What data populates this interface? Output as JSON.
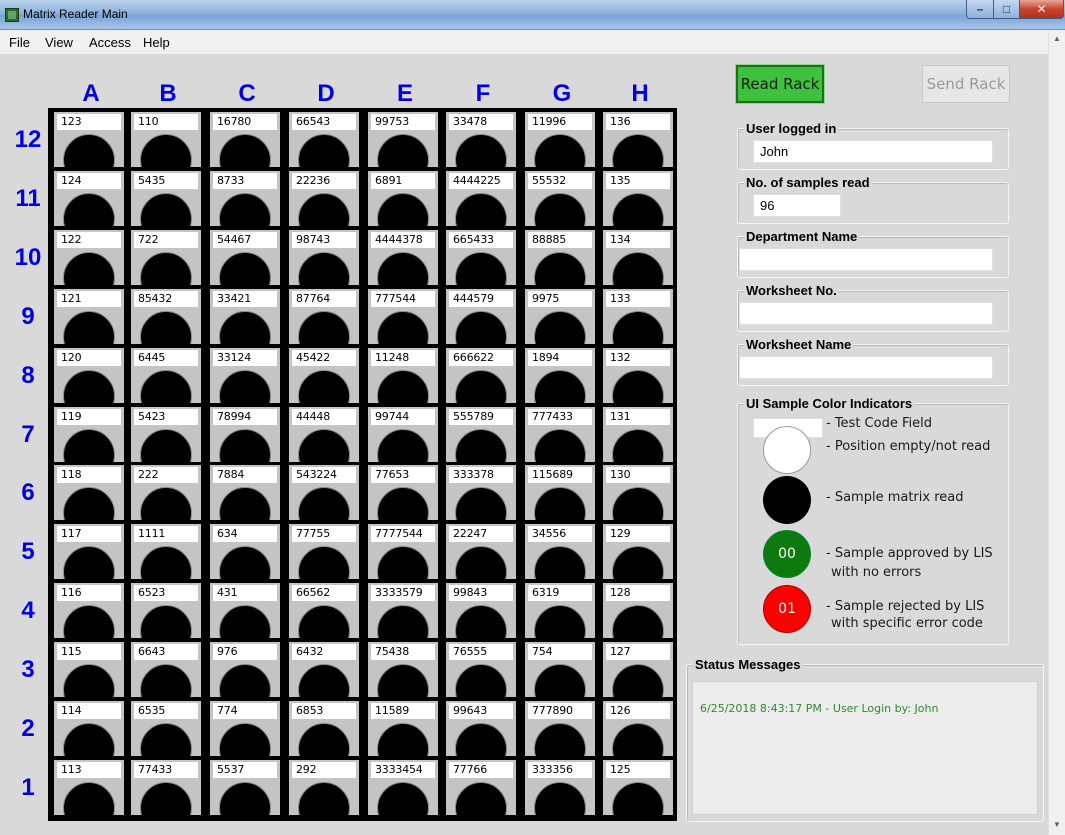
{
  "window": {
    "title": "Matrix Reader Main",
    "minimize": "–",
    "maximize": "□",
    "close": "✕"
  },
  "menu": [
    "File",
    "View",
    "Access",
    "Help"
  ],
  "rack": {
    "columns": [
      "A",
      "B",
      "C",
      "D",
      "E",
      "F",
      "G",
      "H"
    ],
    "rows": [
      "12",
      "11",
      "10",
      "9",
      "8",
      "7",
      "6",
      "5",
      "4",
      "3",
      "2",
      "1"
    ],
    "cells": [
      [
        "123",
        "110",
        "16780",
        "66543",
        "99753",
        "33478",
        "11996",
        "136"
      ],
      [
        "124",
        "5435",
        "8733",
        "22236",
        "6891",
        "4444225",
        "55532",
        "135"
      ],
      [
        "122",
        "722",
        "54467",
        "98743",
        "4444378",
        "665433",
        "88885",
        "134"
      ],
      [
        "121",
        "85432",
        "33421",
        "87764",
        "777544",
        "444579",
        "9975",
        "133"
      ],
      [
        "120",
        "6445",
        "33124",
        "45422",
        "11248",
        "666622",
        "1894",
        "132"
      ],
      [
        "119",
        "5423",
        "78994",
        "44448",
        "99744",
        "555789",
        "777433",
        "131"
      ],
      [
        "118",
        "222",
        "7884",
        "543224",
        "77653",
        "333378",
        "115689",
        "130"
      ],
      [
        "117",
        "1111",
        "634",
        "77755",
        "7777544",
        "22247",
        "34556",
        "129"
      ],
      [
        "116",
        "6523",
        "431",
        "66562",
        "3333579",
        "99843",
        "6319",
        "128"
      ],
      [
        "115",
        "6643",
        "976",
        "6432",
        "75438",
        "76555",
        "754",
        "127"
      ],
      [
        "114",
        "6535",
        "774",
        "6853",
        "11589",
        "99643",
        "777890",
        "126"
      ],
      [
        "113",
        "77433",
        "5537",
        "292",
        "3333454",
        "77766",
        "333356",
        "125"
      ]
    ]
  },
  "buttons": {
    "read_rack": "Read Rack",
    "send_rack": "Send Rack"
  },
  "fields": {
    "user_logged_in": {
      "label": "User logged in",
      "value": "John"
    },
    "samples_read": {
      "label": "No. of samples read",
      "value": "96"
    },
    "department_name": {
      "label": "Department Name",
      "value": ""
    },
    "worksheet_no": {
      "label": "Worksheet No.",
      "value": ""
    },
    "worksheet_name": {
      "label": "Worksheet Name",
      "value": ""
    }
  },
  "indicators": {
    "title": "UI Sample Color Indicators",
    "test_code": "- Test Code Field",
    "empty": "- Position empty/not read",
    "read": "- Sample matrix read",
    "approved_code": "00",
    "approved_line1": "- Sample approved by LIS",
    "approved_line2": "with no errors",
    "rejected_code": "01",
    "rejected_line1": "- Sample rejected by LIS",
    "rejected_line2": "with specific error code",
    "colors": {
      "empty": "#ffffff",
      "read": "#000000",
      "approved": "#0d7a0d",
      "rejected": "#ff0000"
    }
  },
  "status": {
    "title": "Status Messages",
    "messages": [
      "6/25/2018 8:43:17 PM - User Login by: John"
    ]
  }
}
